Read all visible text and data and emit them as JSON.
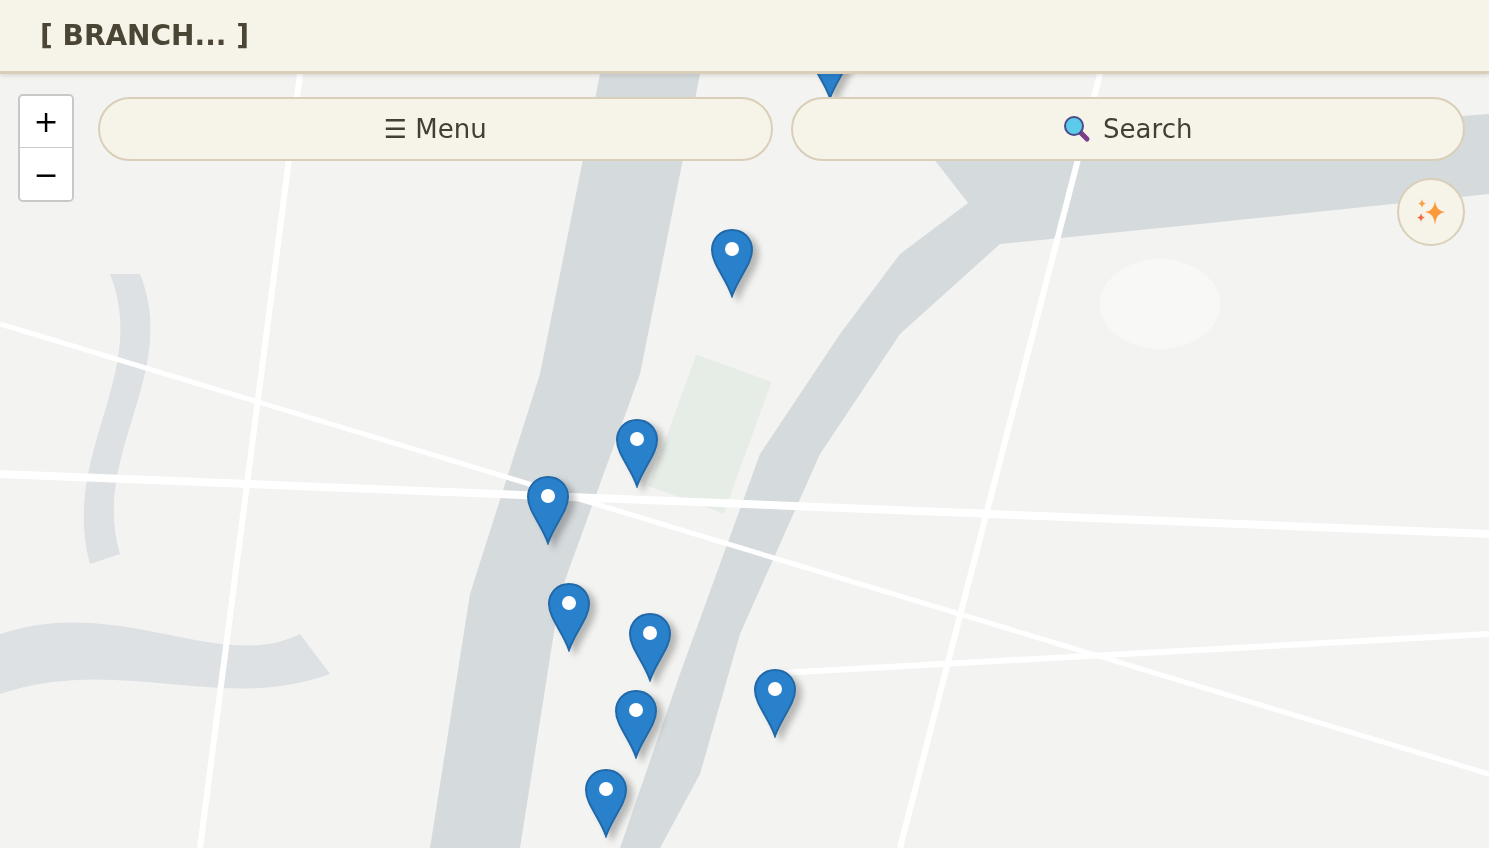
{
  "header": {
    "title": "[ BRANCH... ]"
  },
  "zoom_controls": [
    "+",
    "−"
  ],
  "menu_button": {
    "label": "☰ Menu"
  },
  "search_button": {
    "label": "Search"
  }
}
